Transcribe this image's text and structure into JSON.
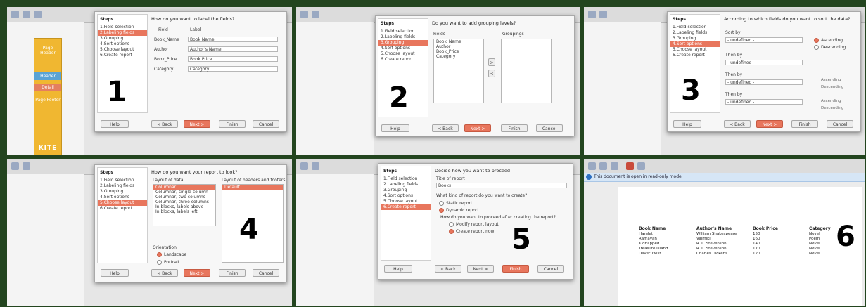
{
  "common": {
    "kite": "KITE",
    "page_header": "Page Header",
    "page_footer": "Page Footer",
    "header": "Header",
    "detail": "Detail",
    "steps_title": "Steps",
    "steps": [
      "1.Field selection",
      "2.Labeling fields",
      "3.Grouping",
      "4.Sort options",
      "5.Choose layout",
      "6.Create report"
    ],
    "buttons": {
      "help": "Help",
      "back": "< Back",
      "next": "Next >",
      "finish": "Finish",
      "cancel": "Cancel"
    }
  },
  "panel1": {
    "number": "1",
    "question": "How do you want to label the fields?",
    "col_field": "Field",
    "col_label": "Label",
    "rows": [
      {
        "field": "Book_Name",
        "label": "Book Name"
      },
      {
        "field": "Author",
        "label": "Author's Name"
      },
      {
        "field": "Book_Price",
        "label": "Book Price"
      },
      {
        "field": "Category",
        "label": "Category"
      }
    ]
  },
  "panel2": {
    "number": "2",
    "question": "Do you want to add grouping levels?",
    "fields_label": "Fields",
    "groupings_label": "Groupings",
    "fields": [
      "Book_Name",
      "Author",
      "Book_Price",
      "Category"
    ]
  },
  "panel3": {
    "number": "3",
    "question": "According to which fields do you want to sort the data?",
    "sort_by": "Sort by",
    "then_by": "Then by",
    "none": "- undefined -",
    "ascending": "Ascending",
    "descending": "Descending"
  },
  "panel4": {
    "number": "4",
    "question": "How do you want your report to look?",
    "layout_data_label": "Layout of data",
    "layout_hf_label": "Layout of headers and footers",
    "layouts": [
      "Columnar",
      "Columnar, single-column",
      "Columnar, two columns",
      "Columnar, three columns",
      "In blocks, labels above",
      "In blocks, labels left"
    ],
    "hf_selected": "Default",
    "orientation_label": "Orientation",
    "landscape": "Landscape",
    "portrait": "Portrait"
  },
  "panel5": {
    "number": "5",
    "question": "Decide how you want to proceed",
    "title_label": "Title of report",
    "title_value": "Books",
    "kind_label": "What kind of report do you want to create?",
    "static": "Static report",
    "dynamic": "Dynamic report",
    "proceed_label": "How do you want to proceed after creating the report?",
    "modify": "Modify report layout",
    "create_now": "Create report now"
  },
  "panel6": {
    "number": "6",
    "readonly_msg": "This document is open in read-only mode.",
    "headers": [
      "Book Name",
      "Author's Name",
      "Book Price",
      "Category"
    ],
    "rows": [
      [
        "Hamlet",
        "William Shakespeare",
        "150",
        "Novel"
      ],
      [
        "Ramayan",
        "Valmiki",
        "160",
        "Poem"
      ],
      [
        "Kidnapped",
        "R. L. Stevenson",
        "140",
        "Novel"
      ],
      [
        "Treasure Island",
        "R. L. Stevenson",
        "170",
        "Novel"
      ],
      [
        "Oliver Twist",
        "Charles Dickens",
        "120",
        "Novel"
      ]
    ]
  }
}
